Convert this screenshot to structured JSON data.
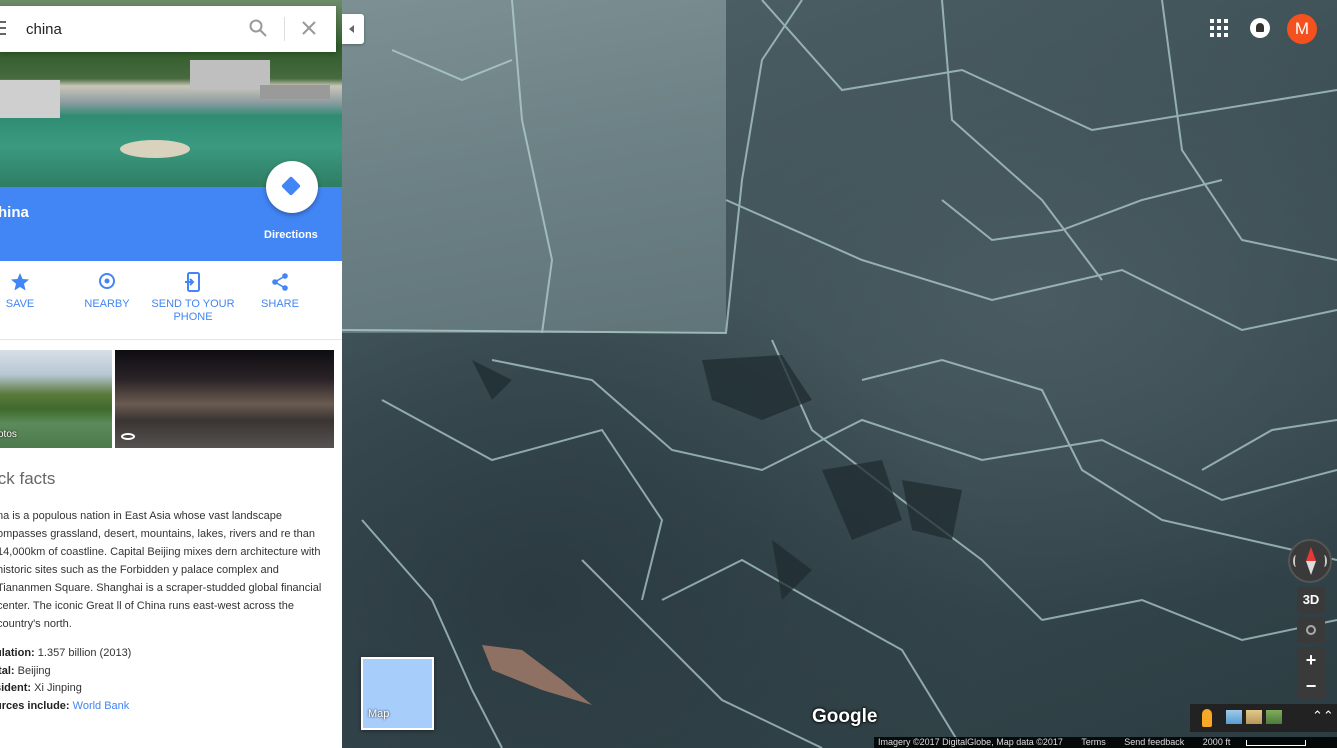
{
  "search": {
    "value": "china"
  },
  "place": {
    "title": "hina",
    "directions_label": "Directions"
  },
  "actions": [
    {
      "label": "SAVE"
    },
    {
      "label": "NEARBY"
    },
    {
      "label": "SEND TO YOUR PHONE"
    },
    {
      "label": "SHARE"
    }
  ],
  "photos": {
    "label": "otos"
  },
  "quick_facts": {
    "title": "ick facts",
    "description": "na is a populous nation in East Asia whose vast landscape ompasses grassland, desert, mountains, lakes, rivers and re than 14,000km of coastline. Capital Beijing mixes dern architecture with historic sites such as the Forbidden y palace complex and Tiananmen Square. Shanghai is a scraper-studded global financial center. The iconic Great ll of China runs east-west across the country's north.",
    "population_label": "ulation:",
    "population_value": "1.357 billion (2013)",
    "capital_label": "ital:",
    "capital_value": "Beijing",
    "president_label": "sident:",
    "president_value": "Xi Jinping",
    "sources_label": "urces include:",
    "sources_value": "World Bank"
  },
  "map": {
    "avatar_letter": "M",
    "control_3d": "3D",
    "zoom_in": "+",
    "zoom_out": "−",
    "minimap_label": "Map",
    "logo": "Google",
    "attribution": "Imagery ©2017 DigitalGlobe, Map data ©2017",
    "terms": "Terms",
    "feedback": "Send feedback",
    "scale": "2000 ft"
  },
  "colors": {
    "accent": "#4285f4",
    "avatar": "#f4511e"
  },
  "icons": [
    "menu-icon",
    "search-icon",
    "close-icon",
    "directions-icon",
    "star-icon",
    "location-pin-icon",
    "send-to-phone-icon",
    "share-icon",
    "panorama-icon",
    "apps-grid-icon",
    "notifications-icon",
    "compass-icon",
    "my-location-icon",
    "pegman-icon",
    "chevron-up-icon",
    "collapse-arrow-icon"
  ]
}
